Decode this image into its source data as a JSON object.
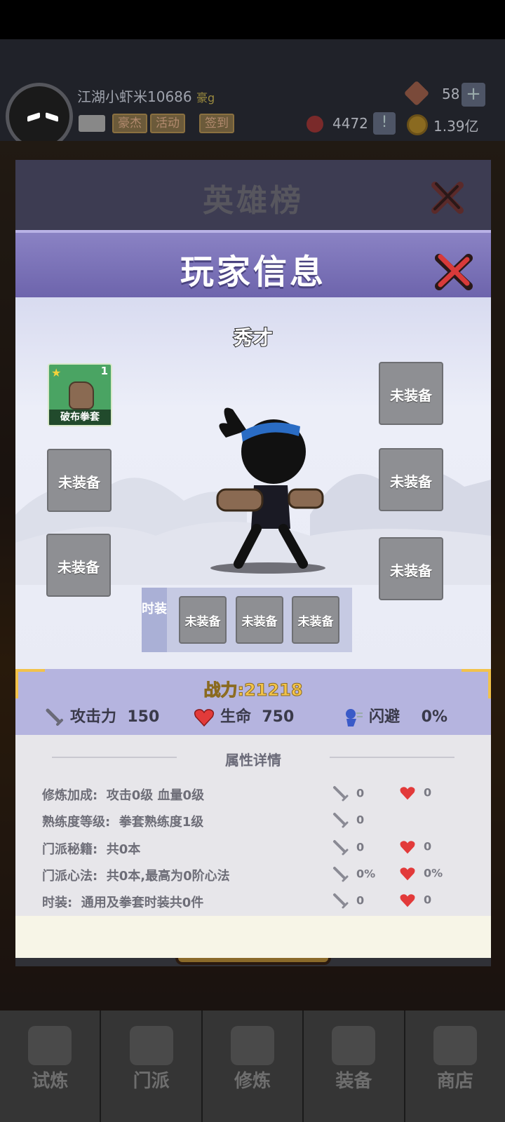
{
  "topbar": {
    "player_name": "江湖小虾米10686",
    "player_tag": "豪g",
    "buttons": [
      "豪杰",
      "活动",
      "签到"
    ],
    "gems": "58",
    "plus": "+",
    "honor": "4472",
    "excl": "!",
    "gold": "1.39亿"
  },
  "back_modal": {
    "title": "英雄榜"
  },
  "modal": {
    "title": "玩家信息",
    "rank": "秀才",
    "equipped_item": {
      "name": "破布拳套",
      "level": "1"
    },
    "empty_slot_label": "未装备",
    "fashion_label": "时装",
    "power": "战力:21218",
    "stats": {
      "attack_label": "攻击力",
      "attack_value": "150",
      "hp_label": "生命",
      "hp_value": "750",
      "dodge_label": "闪避",
      "dodge_value": "0%"
    },
    "detail_title": "属性详情",
    "details": [
      {
        "label": "修炼加成:",
        "value": "攻击0级 血量0级",
        "atk": "0",
        "hp": "0"
      },
      {
        "label": "熟练度等级:",
        "value": "拳套熟练度1级",
        "atk": "0",
        "hp": ""
      },
      {
        "label": "门派秘籍:",
        "value": "共0本",
        "atk": "0",
        "hp": "0"
      },
      {
        "label": "门派心法:",
        "value": "共0本,最高为0阶心法",
        "atk": "0%",
        "hp": "0%"
      },
      {
        "label": "时装:",
        "value": "通用及拳套时装共0件",
        "atk": "0",
        "hp": "0"
      }
    ]
  },
  "bottom_nav": [
    "试炼",
    "门派",
    "修炼",
    "装备",
    "商店"
  ],
  "colors": {
    "header_purple": "#6d64ac",
    "power_gold": "#f4c44a",
    "slot_gray": "#8e8f93",
    "equip_green": "#4aa463"
  }
}
